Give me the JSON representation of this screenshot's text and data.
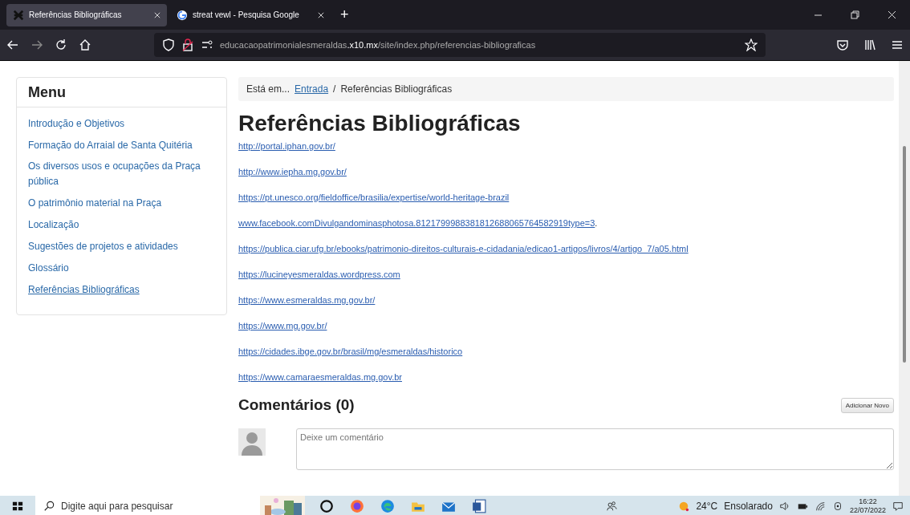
{
  "browser": {
    "tabs": [
      {
        "title": "Referências Bibliográficas",
        "selected": true,
        "kind": "site"
      },
      {
        "title": "streat vewl - Pesquisa Google",
        "selected": false,
        "kind": "search"
      }
    ],
    "new_tab": "+",
    "address": "educacaopatrimonialesmeraldas**.x10.mx**/site/index.php/referencias-bibliograficas"
  },
  "sidebar": {
    "title": "Menu",
    "items": [
      {
        "label": "Introdução e Objetivos",
        "selected": false
      },
      {
        "label": "Formação do Arraial de Santa Quitéria",
        "selected": false
      },
      {
        "label": "Os diversos usos e ocupações da Praça pública",
        "selected": false
      },
      {
        "label": "O patrimônio material na Praça",
        "selected": false
      },
      {
        "label": "Localização",
        "selected": false
      },
      {
        "label": "Sugestões de projetos e atividades",
        "selected": false
      },
      {
        "label": "Glossário",
        "selected": false
      },
      {
        "label": "Referências Bibliográficas",
        "selected": true
      }
    ]
  },
  "breadcrumb": {
    "prefix": "Está em...",
    "link": "Entrada",
    "separator": "/",
    "current": "Referências Bibliográficas"
  },
  "title": "Referências Bibliográficas",
  "links": [
    {
      "text": "http://portal.iphan.gov.br/"
    },
    {
      "text": "http://www.iepha.mg.gov.br/"
    },
    {
      "text": "https://pt.unesco.org/fieldoffice/brasilia/expertise/world-heritage-brazil"
    },
    {
      "text": "www.facebook.comDivulgandominasphotosa.8121799988381812688065764582919type=3",
      "after": "."
    },
    {
      "text": "https://publica.ciar.ufg.br/ebooks/patrimonio-direitos-culturais-e-cidadania/edicao1-artigos/livros/4/artigo_7/a05.html"
    },
    {
      "text": "https://lucineyesmeraldas.wordpress.com"
    },
    {
      "text": "https://www.esmeraldas.mg.gov.br/"
    },
    {
      "text": "https://www.mg.gov.br/"
    },
    {
      "text": "https://cidades.ibge.gov.br/brasil/mg/esmeraldas/historico"
    },
    {
      "text": "https://www.camaraesmeraldas.mg.gov.br"
    }
  ],
  "comments": {
    "title": "Comentários (0)",
    "add_button": "Adicionar Novo",
    "placeholder": "Deixe um comentário"
  },
  "taskbar": {
    "search_placeholder": "Digite aqui para pesquisar",
    "temperature": "24°C",
    "weather": "Ensolarado",
    "time": "16:22",
    "date": "22/07/2022"
  }
}
